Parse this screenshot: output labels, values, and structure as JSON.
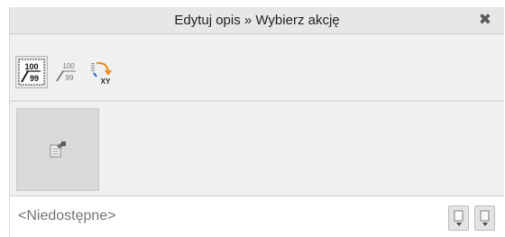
{
  "window": {
    "title": "Edytuj opis » Wybierz akcję",
    "close_symbol": "✖"
  },
  "toolbar": {
    "buttons": [
      {
        "name": "dimension-description-icon",
        "top_value": "100",
        "bottom_value": "99",
        "active": true
      },
      {
        "name": "dimension-description-light-icon",
        "top_value": "100",
        "bottom_value": "99",
        "active": false
      },
      {
        "name": "xy-coordinates-icon",
        "label": "XY",
        "active": false
      }
    ]
  },
  "action_area": {
    "selected_action_icon": "edit-properties-icon"
  },
  "bottom": {
    "status_text": "<Niedostępne>",
    "buttons": [
      "insert-down-icon",
      "move-down-icon"
    ]
  },
  "colors": {
    "accent_orange": "#f08a1a",
    "accent_blue": "#2a6fc9"
  }
}
